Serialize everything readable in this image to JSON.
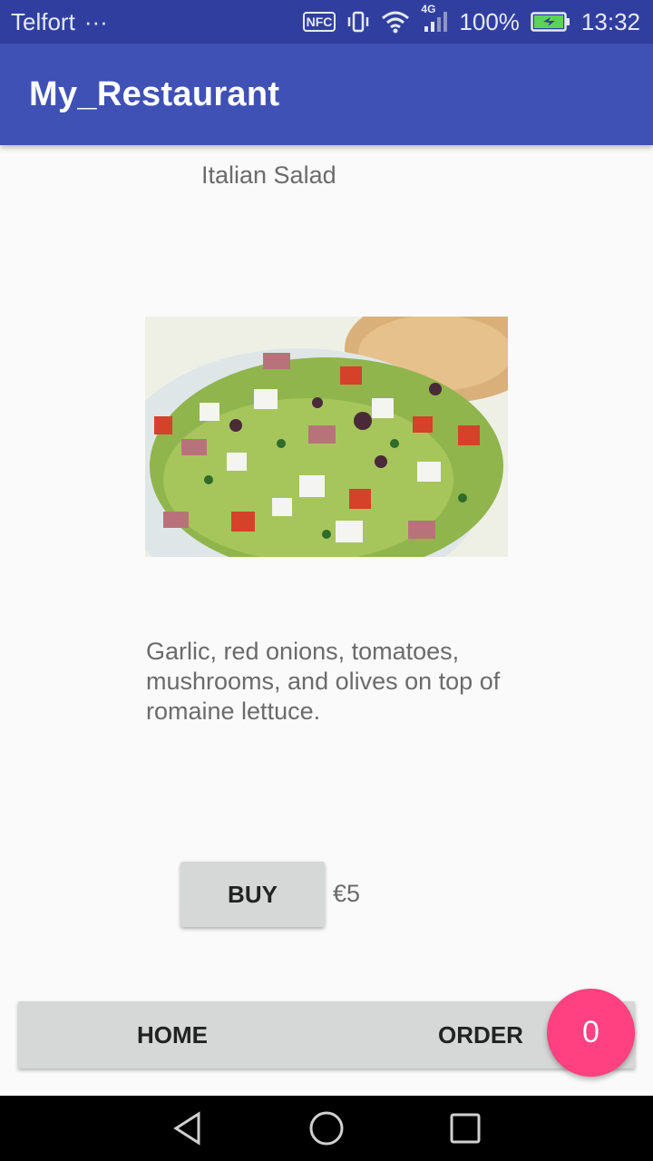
{
  "status_bar": {
    "carrier": "Telfort",
    "more": "···",
    "nfc": "NFC",
    "network": "4G",
    "battery": "100%",
    "time": "13:32"
  },
  "app_bar": {
    "title": "My_Restaurant"
  },
  "item": {
    "name": "Italian Salad",
    "description": "Garlic, red onions, tomatoes, mushrooms, and olives on top of romaine lettuce.",
    "buy_label": "BUY",
    "price": "€5"
  },
  "bottom_nav": {
    "home_label": "HOME",
    "order_label": "ORDER"
  },
  "cart": {
    "count": "0"
  },
  "colors": {
    "primary": "#3f51b5",
    "primary_dark": "#303f9f",
    "accent": "#ff4081"
  },
  "icons": [
    "vibrate-icon",
    "wifi-icon",
    "signal-icon",
    "battery-charging-icon",
    "nav-back-icon",
    "nav-home-icon",
    "nav-recents-icon"
  ]
}
